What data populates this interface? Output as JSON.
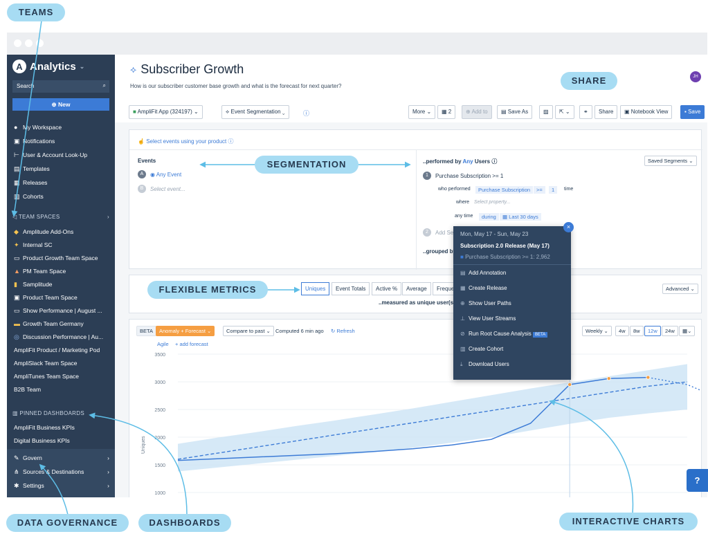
{
  "sidebar": {
    "app_title": "Analytics",
    "search_placeholder": "Search",
    "new_label": "New",
    "nav": [
      {
        "label": "My Workspace",
        "icon": "user-icon"
      },
      {
        "label": "Notifications",
        "icon": "bell-icon"
      },
      {
        "label": "User & Account Look-Up",
        "icon": "lookup-icon"
      },
      {
        "label": "Templates",
        "icon": "template-icon"
      },
      {
        "label": "Releases",
        "icon": "release-icon"
      },
      {
        "label": "Cohorts",
        "icon": "cohort-icon"
      }
    ],
    "team_spaces_label": "TEAM SPACES",
    "team_spaces": [
      "Amplitude Add-Ons",
      "Internal SC",
      "Product Growth Team Space",
      "PM Team Space",
      "Samplitude",
      "Product Team Space",
      "Show Performance | August ...",
      "Growth Team Germany",
      "Discussion Performance | Au...",
      "AmpliFit Product / Marketing Pod",
      "AmpliSlack Team Space",
      "AmpliTunes Team Space",
      "B2B Team"
    ],
    "pinned_label": "PINNED DASHBOARDS",
    "pinned": [
      "AmpliFit Business KPIs",
      "Digital Business KPIs"
    ],
    "bottom": [
      "Govern",
      "Sources & Destinations",
      "Settings"
    ]
  },
  "header": {
    "title": "Subscriber Growth",
    "subtitle": "How is our subscriber customer base growth and what is the forecast for next quarter?",
    "avatar": "JH"
  },
  "toolbar": {
    "app": "AmpliFit App (324197)",
    "chart_type": "Event Segmentation",
    "more": "More",
    "count": "2",
    "add_to": "Add to",
    "save_as": "Save As",
    "share": "Share",
    "notebook": "Notebook View",
    "save": "Save"
  },
  "events": {
    "select_prompt": "Select events using your product",
    "heading": "Events",
    "any_event": "Any Event",
    "select_event": "Select event...",
    "performed_by": "..performed by",
    "any": "Any",
    "users": "Users",
    "saved_segments": "Saved Segments",
    "condition": "Purchase Subscription >= 1",
    "who_performed": "who performed",
    "who_event": "Purchase Subscription",
    "op": ">=",
    "val": "1",
    "time": "time",
    "where": "where",
    "select_property": "Select property...",
    "any_time": "any time",
    "during": "during",
    "last30": "Last 30 days",
    "add_seg": "Add Se",
    "grouped_by": "..grouped by"
  },
  "metrics": {
    "tabs": [
      "Uniques",
      "Event Totals",
      "Active %",
      "Average",
      "Frequenc"
    ],
    "measured": "..measured as unique user(s)",
    "advanced": "Advanced"
  },
  "chart_controls": {
    "beta": "BETA",
    "anomaly": "Anomaly + Forecast",
    "compare": "Compare to past",
    "computed": "Computed 6 min ago",
    "refresh": "Refresh",
    "agile": "Agile",
    "add_forecast": "+ add forecast",
    "weekly": "Weekly",
    "ranges": [
      "4w",
      "8w",
      "12w",
      "24w"
    ]
  },
  "popup": {
    "date": "Mon, May 17 - Sun, May 23",
    "release": "Subscription 2.0 Release (May 17)",
    "metric": "Purchase Subscription >= 1: 2,962",
    "actions": [
      {
        "label": "Add Annotation",
        "icon": "annotation-icon"
      },
      {
        "label": "Create Release",
        "icon": "release-icon"
      },
      {
        "label": "Show User Paths",
        "icon": "paths-icon"
      },
      {
        "label": "View User Streams",
        "icon": "streams-icon"
      },
      {
        "label": "Run Root Cause Analysis",
        "icon": "root-cause-icon",
        "badge": "BETA"
      },
      {
        "label": "Create Cohort",
        "icon": "cohort-icon"
      },
      {
        "label": "Download Users",
        "icon": "download-icon"
      }
    ]
  },
  "chart_data": {
    "type": "line",
    "ylabel": "Uniques",
    "yticks": [
      1000,
      1500,
      2000,
      2500,
      3000,
      3500
    ],
    "ylim": [
      900,
      3550
    ],
    "grid": true,
    "x_count": 13,
    "series": [
      {
        "values": [
          1580,
          1610,
          1640,
          1670,
          1700,
          1740,
          1790,
          1860,
          1960,
          2250,
          2950,
          3060,
          3080
        ]
      }
    ],
    "forecast": {
      "values": [
        3080,
        2950,
        2650
      ]
    },
    "trend": {
      "values": [
        1600,
        1710,
        1820,
        1930,
        2040,
        2150,
        2260,
        2370,
        2480,
        2590,
        2700,
        2810,
        2920,
        3000
      ]
    },
    "band_low": [
      1380,
      1450,
      1520,
      1590,
      1660,
      1730,
      1810,
      1900,
      2000,
      2120,
      2240,
      2350,
      2430,
      2500
    ],
    "band_high": [
      1880,
      1990,
      2090,
      2200,
      2300,
      2410,
      2520,
      2640,
      2760,
      2880,
      2990,
      3100,
      3210,
      3320
    ],
    "highlight_index": 10,
    "colors": {
      "line": "#3c7bd6",
      "band": "#cfe5f6",
      "marker": "#f59e42"
    }
  },
  "annotations": {
    "teams": "TEAMS",
    "share": "SHARE",
    "segmentation": "SEGMENTATION",
    "flexible_metrics": "FLEXIBLE METRICS",
    "data_governance": "DATA GOVERNANCE",
    "dashboards": "DASHBOARDS",
    "interactive_charts": "INTERACTIVE CHARTS",
    "help": "?"
  }
}
